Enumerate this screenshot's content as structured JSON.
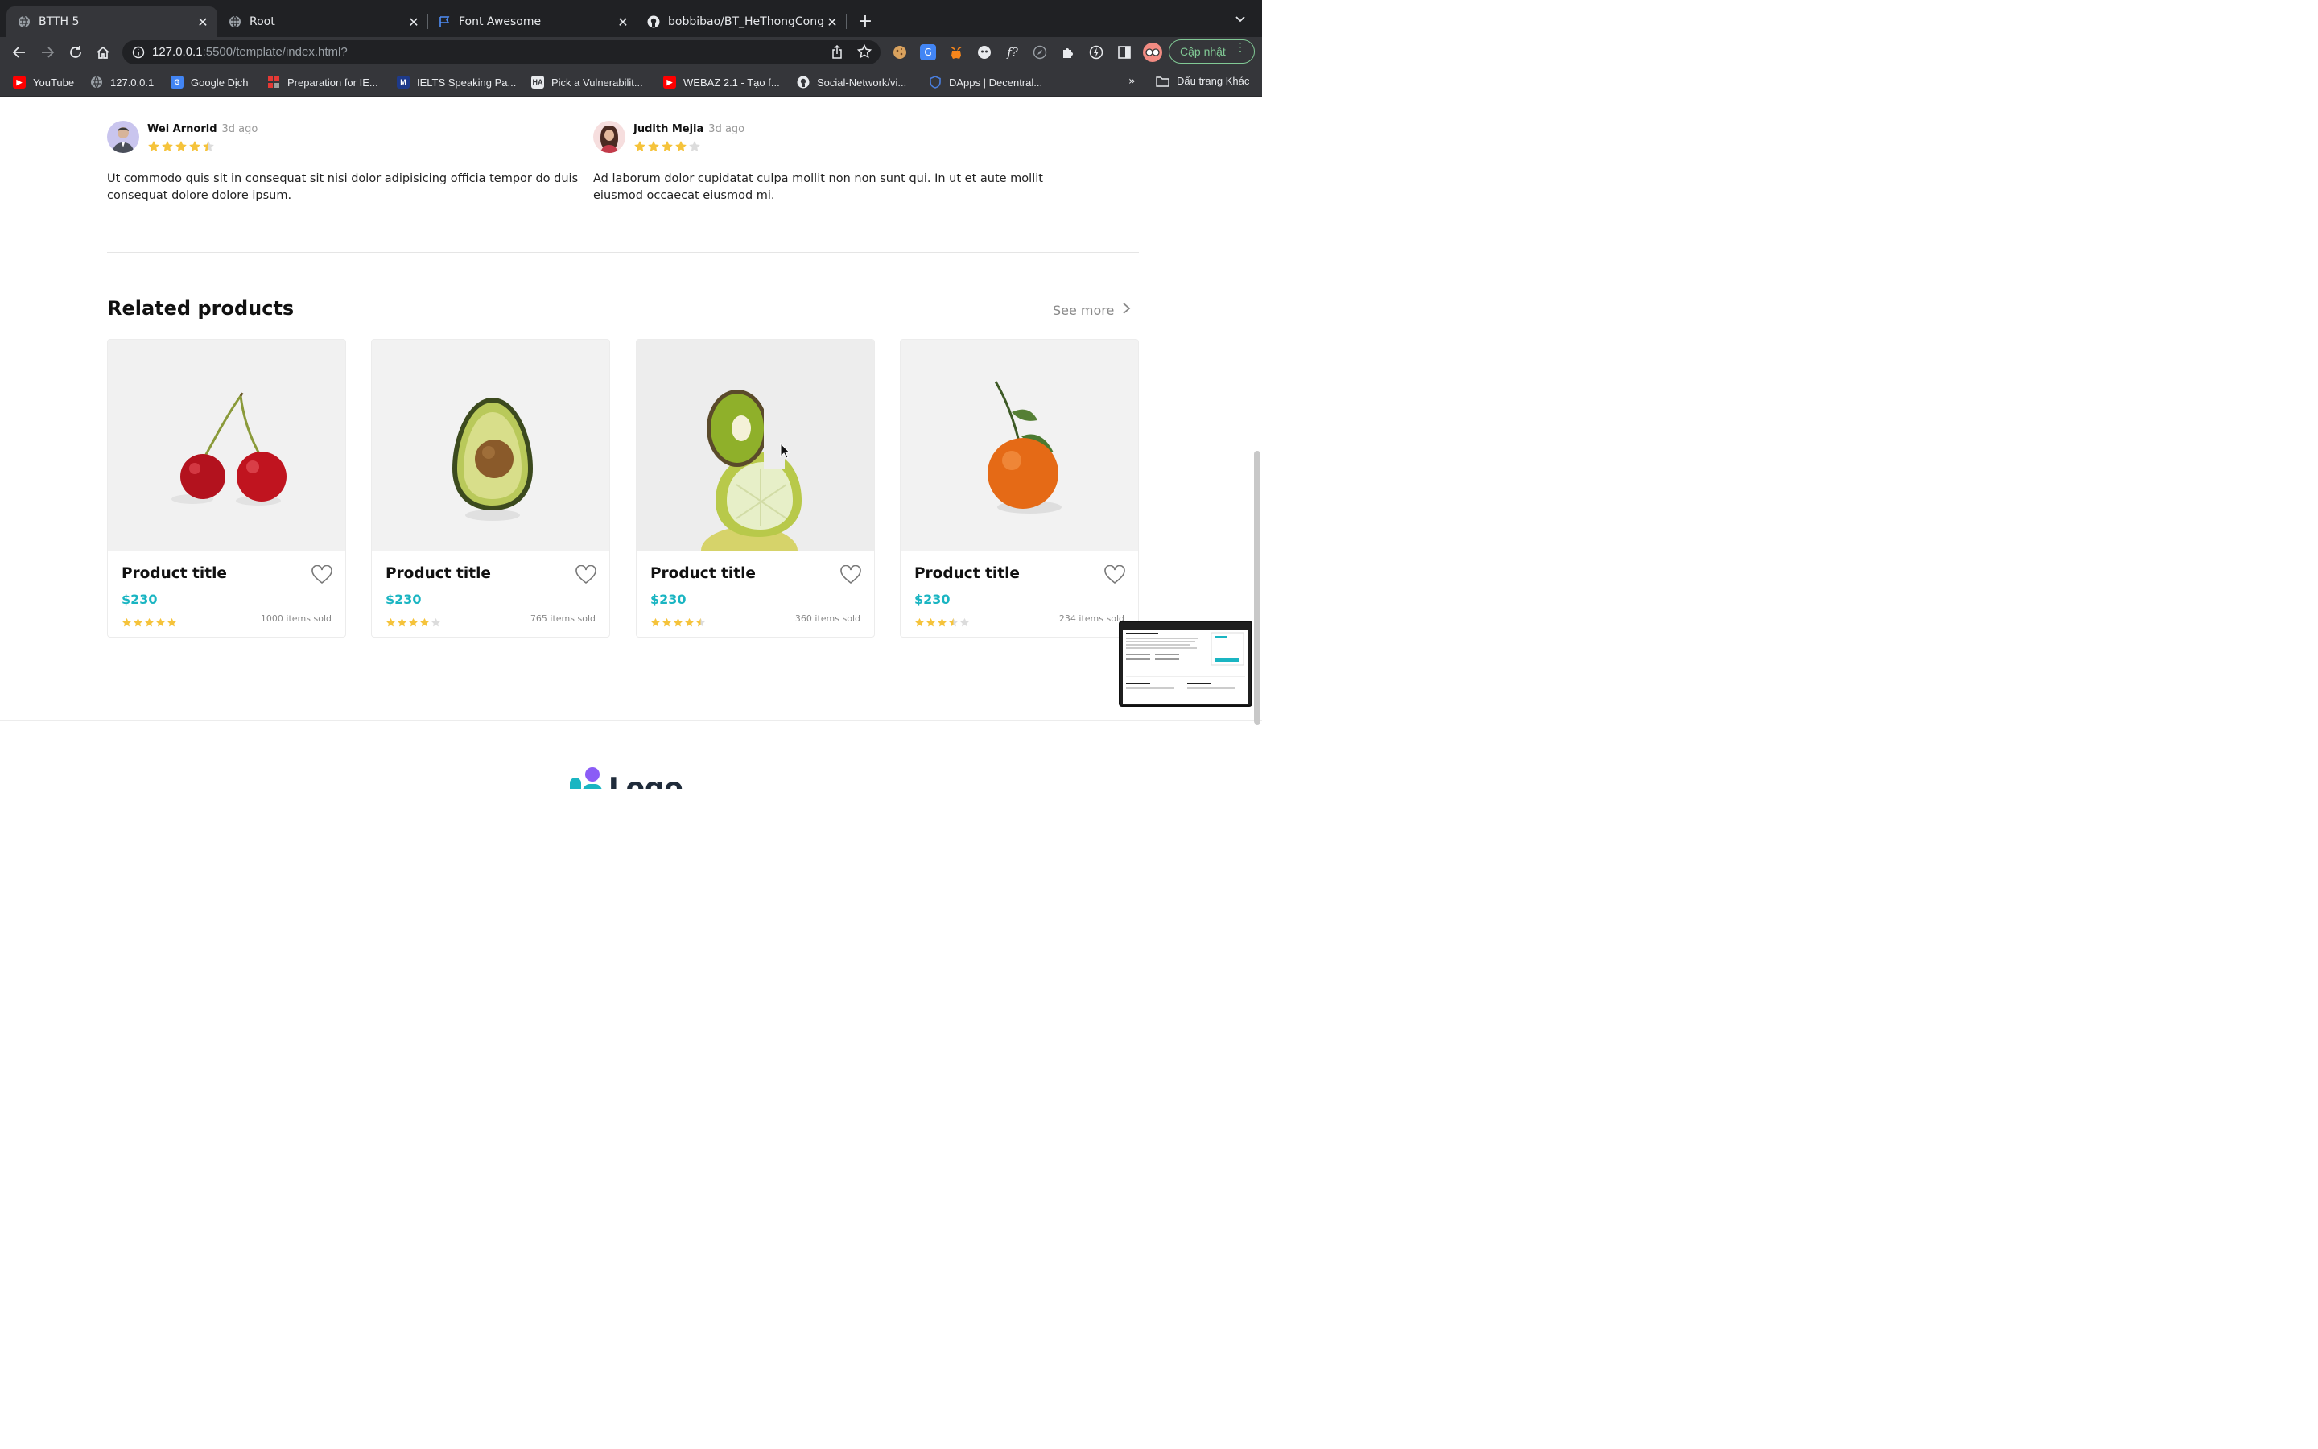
{
  "browser": {
    "tabs": [
      {
        "title": "BTTH 5",
        "active": true,
        "favicon": "globe-icon"
      },
      {
        "title": "Root",
        "active": false,
        "favicon": "globe-icon"
      },
      {
        "title": "Font Awesome",
        "active": false,
        "favicon": "flag-icon"
      },
      {
        "title": "bobbibao/BT_HeThongCongNg",
        "active": false,
        "favicon": "github-icon"
      }
    ],
    "url_host": "127.0.0.1",
    "url_rest": ":5500/template/index.html?",
    "update_label": "Cập nhật",
    "bookmarks": [
      {
        "label": "YouTube",
        "icon": "youtube-icon",
        "color": "#ff0000"
      },
      {
        "label": "127.0.0.1",
        "icon": "globe-icon",
        "color": "#9aa0a6"
      },
      {
        "label": "Google Dịch",
        "icon": "google-translate-icon",
        "color": "#4285f4"
      },
      {
        "label": "Preparation for IE...",
        "icon": "grid-icon",
        "color": "#e53935"
      },
      {
        "label": "IELTS Speaking Pa...",
        "icon": "ielts-icon",
        "color": "#1e3a8a"
      },
      {
        "label": "Pick a Vulnerabilit...",
        "icon": "ha-icon",
        "color": "#e8eaed"
      },
      {
        "label": "WEBAZ 2.1 - Tạo f...",
        "icon": "youtube-icon",
        "color": "#ff0000"
      },
      {
        "label": "Social-Network/vi...",
        "icon": "github-icon",
        "color": "#e8eaed"
      },
      {
        "label": "DApps | Decentral...",
        "icon": "shield-icon",
        "color": "#4a7fe0"
      }
    ],
    "bookmarks_more": "»",
    "bookmarks_folder": "Dấu trang Khác"
  },
  "reviews": [
    {
      "name": "Wei Arnorld",
      "ago": "3d ago",
      "rating": 4.5,
      "text": "Ut commodo quis sit in consequat sit nisi dolor adipisicing officia tempor do duis consequat dolore dolore ipsum."
    },
    {
      "name": "Judith Mejia",
      "ago": "3d ago",
      "rating": 4,
      "text": "Ad laborum dolor cupidatat culpa mollit non non sunt qui. In ut et aute mollit eiusmod occaecat eiusmod mi."
    }
  ],
  "related": {
    "title": "Related products",
    "see_more": "See more",
    "products": [
      {
        "title": "Product title",
        "price": "$230",
        "rating": 5,
        "sold": "1000 items sold",
        "image": "cherries"
      },
      {
        "title": "Product title",
        "price": "$230",
        "rating": 4,
        "sold": "765 items sold",
        "image": "avocado"
      },
      {
        "title": "Product title",
        "price": "$230",
        "rating": 4.5,
        "sold": "360 items sold",
        "image": "kiwi-lime"
      },
      {
        "title": "Product title",
        "price": "$230",
        "rating": 3.5,
        "sold": "234 items sold",
        "image": "tangerine"
      }
    ]
  },
  "footer": {
    "logo_text": "Logo"
  },
  "colors": {
    "accent": "#1ab5c2",
    "star": "#f5c33b",
    "star_empty": "#dcdcdc"
  }
}
